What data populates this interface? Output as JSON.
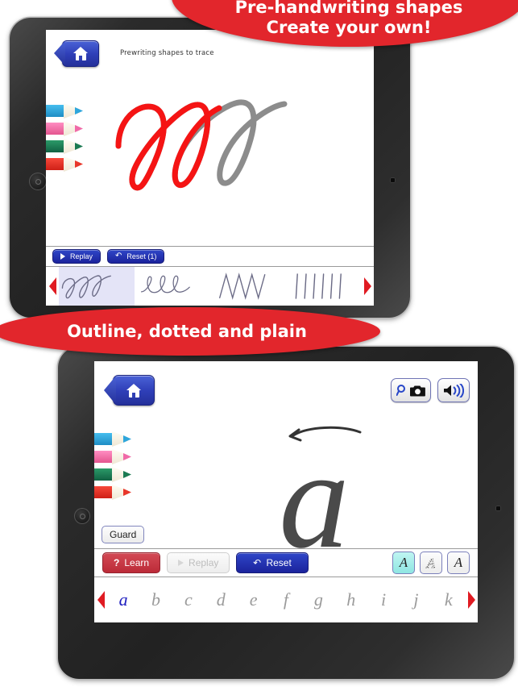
{
  "banners": [
    {
      "line1": "Pre-handwriting shapes",
      "line2": "Create your own!"
    },
    {
      "line1": "Outline, dotted and plain"
    }
  ],
  "colors": {
    "banner_red": "#e2262c",
    "button_blue": "#2331a8",
    "button_red": "#c4303c",
    "arrow_red": "#e01b22",
    "selected_cyan": "#8fe6e2",
    "selected_lavender": "#e4e4f7",
    "trace_red": "#f51414",
    "trace_gray": "#8c8c8c",
    "letter_gray": "#4a4a4a",
    "selected_letter_blue": "#2020c0"
  },
  "tablet_one": {
    "topbar": {
      "home_label": "home-icon",
      "title": "Prewriting shapes to trace"
    },
    "canvas": {
      "pencils": [
        "#2ea6dc",
        "#f06aa8",
        "#1b7a52",
        "#e8362a"
      ],
      "trace_progress_note": "red stroke traced over first loops of gray guide"
    },
    "actions": [
      {
        "id": "replay",
        "label": "Replay",
        "icon": "play-icon",
        "style": "blue",
        "enabled": true
      },
      {
        "id": "reset",
        "label": "Reset (1)",
        "icon": "undo-icon",
        "style": "blue",
        "enabled": true
      }
    ],
    "picker": {
      "left_arrow": "prev-arrow-icon",
      "right_arrow": "next-arrow-icon",
      "items": [
        {
          "name": "loops",
          "selected": true
        },
        {
          "name": "cursive-e-chain",
          "selected": false
        },
        {
          "name": "zigzag",
          "selected": false
        },
        {
          "name": "vertical-lines",
          "selected": false
        }
      ]
    }
  },
  "tablet_two": {
    "topbar": {
      "home_label": "home-icon",
      "buttons": [
        {
          "id": "photo",
          "icons": [
            "magnifier-icon",
            "camera-icon"
          ]
        },
        {
          "id": "sound",
          "icons": [
            "speaker-icon"
          ]
        }
      ]
    },
    "canvas": {
      "pencils": [
        "#2ea6dc",
        "#f06aa8",
        "#1b7a52",
        "#e8362a"
      ],
      "letter": "a",
      "stroke_arrow": "stroke-direction-arrow",
      "guard_label": "Guard"
    },
    "actions": [
      {
        "id": "learn",
        "label": "Learn",
        "icon": "question-icon",
        "style": "red",
        "enabled": true
      },
      {
        "id": "replay",
        "label": "Replay",
        "icon": "play-icon",
        "style": "ghost",
        "enabled": false
      },
      {
        "id": "reset",
        "label": "Reset",
        "icon": "undo-icon",
        "style": "blue",
        "enabled": true
      }
    ],
    "style_buttons": [
      {
        "id": "outline",
        "label": "A",
        "selected": true
      },
      {
        "id": "dotted",
        "label": "A",
        "selected": false
      },
      {
        "id": "plain",
        "label": "A",
        "selected": false
      }
    ],
    "picker": {
      "left_arrow": "prev-arrow-icon",
      "right_arrow": "next-arrow-icon",
      "letters": [
        {
          "char": "a",
          "selected": true
        },
        {
          "char": "b",
          "selected": false
        },
        {
          "char": "c",
          "selected": false
        },
        {
          "char": "d",
          "selected": false
        },
        {
          "char": "e",
          "selected": false
        },
        {
          "char": "f",
          "selected": false
        },
        {
          "char": "g",
          "selected": false
        },
        {
          "char": "h",
          "selected": false
        },
        {
          "char": "i",
          "selected": false
        },
        {
          "char": "j",
          "selected": false
        },
        {
          "char": "k",
          "selected": false
        }
      ]
    }
  }
}
